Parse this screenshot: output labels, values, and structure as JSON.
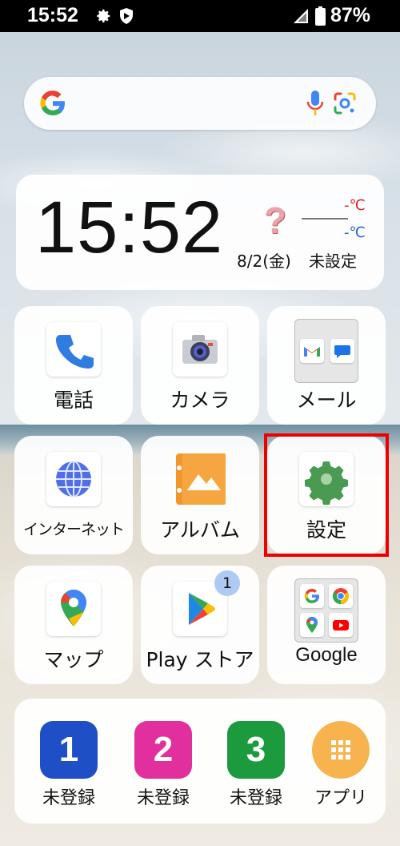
{
  "status_bar": {
    "time": "15:52",
    "battery_percent": "87%"
  },
  "search": {
    "placeholder": ""
  },
  "clock_widget": {
    "time": "15:52",
    "date": "8/2(金)",
    "temp_high": "-℃",
    "temp_low": "-℃",
    "location": "未設定",
    "weather": "?"
  },
  "apps": [
    {
      "label": "電話"
    },
    {
      "label": "カメラ"
    },
    {
      "label": "メール"
    },
    {
      "label": "インターネット"
    },
    {
      "label": "アルバム"
    },
    {
      "label": "設定"
    },
    {
      "label": "マップ"
    },
    {
      "label": "Play ストア",
      "badge": "1"
    },
    {
      "label": "Google"
    }
  ],
  "dock": [
    {
      "number": "1",
      "label": "未登録",
      "color": "#1f4fc7"
    },
    {
      "number": "2",
      "label": "未登録",
      "color": "#e22f9e"
    },
    {
      "number": "3",
      "label": "未登録",
      "color": "#1c9a3e"
    },
    {
      "label": "アプリ",
      "color": "#f7b34e"
    }
  ],
  "colors": {
    "highlight": "#ee0000"
  }
}
